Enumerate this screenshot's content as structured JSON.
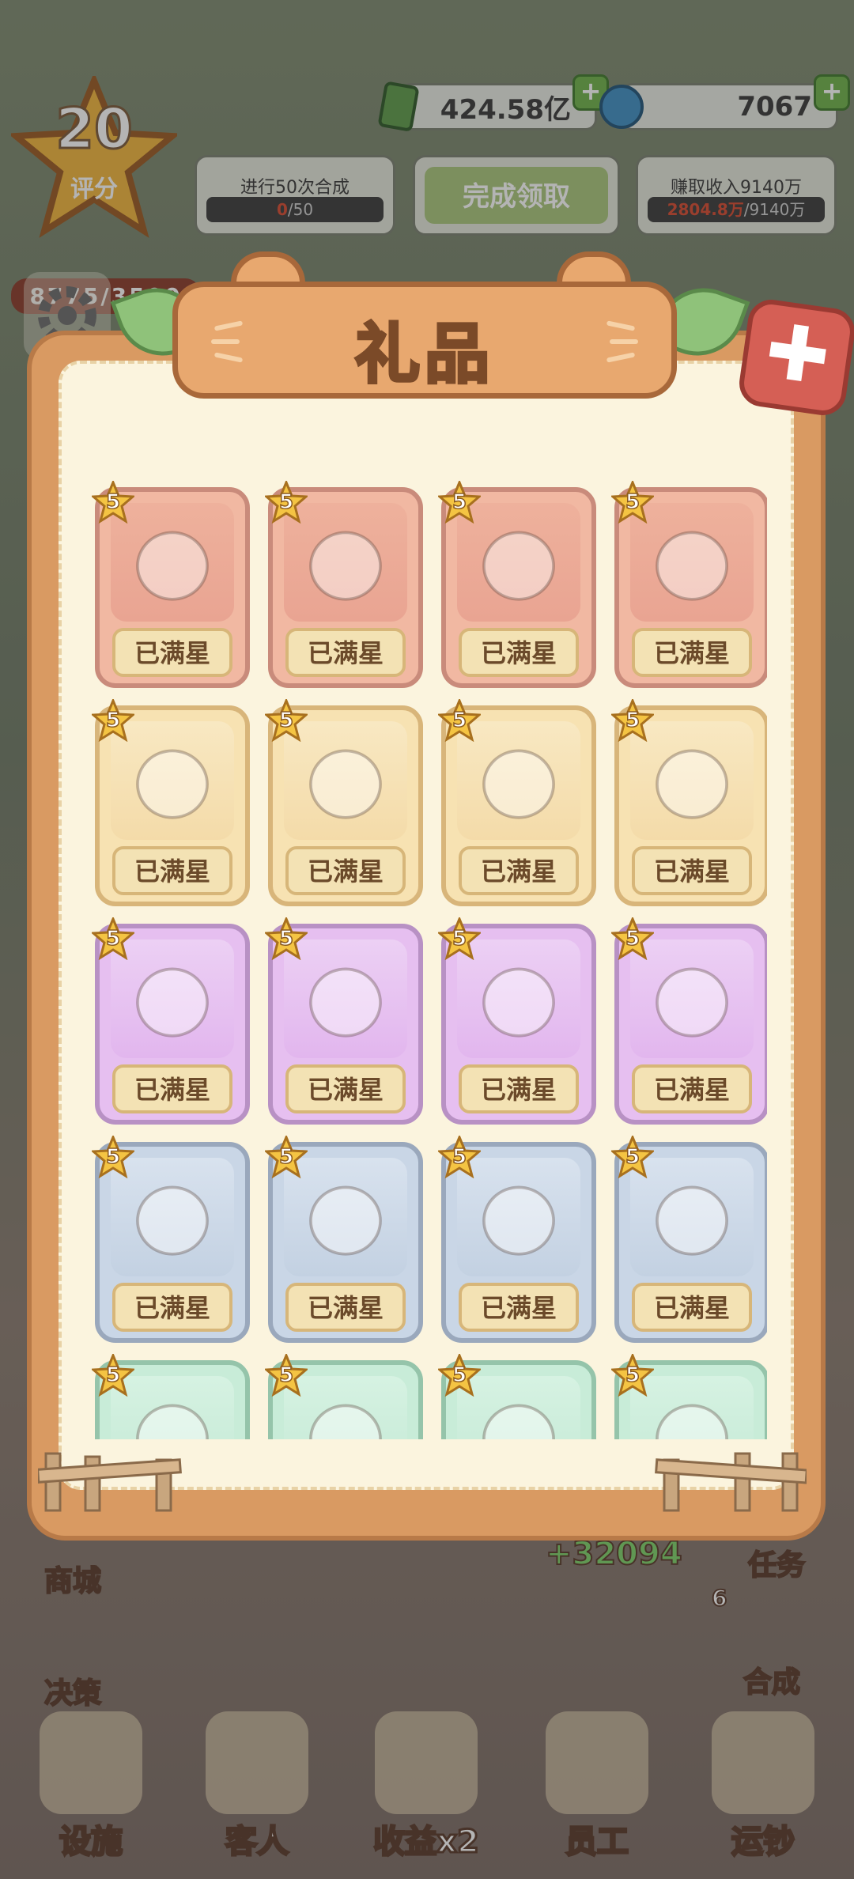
{
  "hud": {
    "level": "20",
    "level_label": "评分",
    "score": "8775/3500",
    "money": "424.58亿",
    "gems": "7067",
    "quests": [
      {
        "title": "进行50次合成",
        "progress_current": "0",
        "progress_total": "/50"
      },
      {
        "button": "完成领取"
      },
      {
        "title": "赚取收入9140万",
        "progress_current": "2804.8万",
        "progress_total": "/9140万"
      }
    ]
  },
  "side": {
    "shop": "商城",
    "decision": "决策",
    "task": "任务",
    "merge": "合成",
    "merge_count": "6",
    "income_float": "+32094"
  },
  "nav": {
    "items": [
      "设施",
      "客人",
      "收益x2",
      "员工",
      "运钞"
    ]
  },
  "dialog": {
    "title": "礼品",
    "close_icon": "close-icon",
    "items": [
      {
        "name": "smartphone-icon",
        "stars": "5",
        "status": "已满星",
        "rarity": "red"
      },
      {
        "name": "game-console-icon",
        "stars": "5",
        "status": "已满星",
        "rarity": "red"
      },
      {
        "name": "headphones-icon",
        "stars": "5",
        "status": "已满星",
        "rarity": "red"
      },
      {
        "name": "juicer-icon",
        "stars": "5",
        "status": "已满星",
        "rarity": "red"
      },
      {
        "name": "toy-car-icon",
        "stars": "5",
        "status": "已满星",
        "rarity": "yellow"
      },
      {
        "name": "suitcase-icon",
        "stars": "5",
        "status": "已满星",
        "rarity": "yellow"
      },
      {
        "name": "soap-bottle-icon",
        "stars": "5",
        "status": "已满星",
        "rarity": "yellow"
      },
      {
        "name": "piggy-bank-icon",
        "stars": "5",
        "status": "已满星",
        "rarity": "yellow"
      },
      {
        "name": "binoculars-icon",
        "stars": "5",
        "status": "已满星",
        "rarity": "purple"
      },
      {
        "name": "teddy-bear-icon",
        "stars": "5",
        "status": "已满星",
        "rarity": "purple"
      },
      {
        "name": "robot-icon",
        "stars": "5",
        "status": "已满星",
        "rarity": "purple"
      },
      {
        "name": "cat-pillow-icon",
        "stars": "5",
        "status": "已满星",
        "rarity": "purple"
      },
      {
        "name": "backpack-icon",
        "stars": "5",
        "status": "已满星",
        "rarity": "blue"
      },
      {
        "name": "air-fryer-icon",
        "stars": "5",
        "status": "已满星",
        "rarity": "blue"
      },
      {
        "name": "cake-icon",
        "stars": "5",
        "status": "已满星",
        "rarity": "blue"
      },
      {
        "name": "toast-icon",
        "stars": "5",
        "status": "已满星",
        "rarity": "blue"
      },
      {
        "name": "drink-bottle-icon",
        "stars": "5",
        "status": "",
        "rarity": "green"
      },
      {
        "name": "fan-icon",
        "stars": "5",
        "status": "",
        "rarity": "green"
      },
      {
        "name": "jar-icon",
        "stars": "5",
        "status": "",
        "rarity": "green"
      },
      {
        "name": "detergent-icon",
        "stars": "5",
        "status": "",
        "rarity": "green"
      }
    ]
  }
}
